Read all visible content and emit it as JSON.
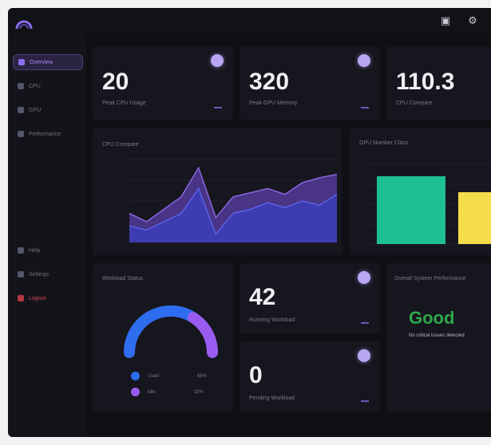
{
  "app": {
    "logo": "dashboard-logo"
  },
  "topbar": {
    "icons": [
      "monitor-icon",
      "settings-icon"
    ]
  },
  "sidebar": {
    "items": [
      {
        "label": "Overview",
        "icon": "grid-icon",
        "state": "active"
      },
      {
        "label": "CPU",
        "icon": "cpu-icon",
        "state": "normal"
      },
      {
        "label": "GPU",
        "icon": "gpu-icon",
        "state": "normal"
      },
      {
        "label": "Performance",
        "icon": "chart-icon",
        "state": "normal"
      }
    ],
    "bottom_items": [
      {
        "label": "Help",
        "icon": "help-icon",
        "state": "normal"
      },
      {
        "label": "Settings",
        "icon": "settings-icon",
        "state": "normal"
      },
      {
        "label": "Logout",
        "icon": "logout-icon",
        "state": "danger"
      }
    ]
  },
  "kpis": [
    {
      "value": "20",
      "label": "Peak CPU Usage"
    },
    {
      "value": "320",
      "label": "Peak GPU Memory"
    },
    {
      "value": "110.3",
      "label": "CPU Compare"
    }
  ],
  "cpu_chart": {
    "title": "CPU Compare",
    "colors": {
      "back": "#5b3fa8",
      "front": "#3b3fb8"
    }
  },
  "gpu_chart": {
    "title": "GPU Number Class",
    "colors": [
      "#1fbf94",
      "#f5dc4a"
    ]
  },
  "workload": {
    "title": "Workload Status",
    "legend": [
      {
        "label": "Used",
        "value": "68%",
        "color": "#2f6df0"
      },
      {
        "label": "Idle",
        "value": "32%",
        "color": "#9a5cf0"
      }
    ]
  },
  "running": {
    "value": "42",
    "label": "Running Workload"
  },
  "pending": {
    "value": "0",
    "label": "Pending Workload"
  },
  "system": {
    "title": "Overall System Performance",
    "status": "Good",
    "note": "No critical issues detected"
  },
  "chart_data": [
    {
      "type": "area",
      "title": "CPU Compare",
      "x": [
        0,
        1,
        2,
        3,
        4,
        5,
        6,
        7,
        8,
        9,
        10,
        11,
        12
      ],
      "ylim": [
        0,
        100
      ],
      "series": [
        {
          "values": [
            35,
            25,
            40,
            55,
            90,
            30,
            55,
            60,
            65,
            58,
            72,
            78,
            82
          ]
        },
        {
          "values": [
            20,
            15,
            25,
            35,
            65,
            10,
            35,
            40,
            48,
            42,
            50,
            45,
            58
          ]
        }
      ]
    },
    {
      "type": "bar",
      "title": "GPU Number Class",
      "categories": [
        "",
        ""
      ],
      "values": [
        85,
        65
      ],
      "ylim": [
        0,
        100
      ]
    },
    {
      "type": "pie",
      "title": "Workload Status",
      "categories": [
        "Used",
        "Idle"
      ],
      "values": [
        68,
        32
      ]
    }
  ]
}
